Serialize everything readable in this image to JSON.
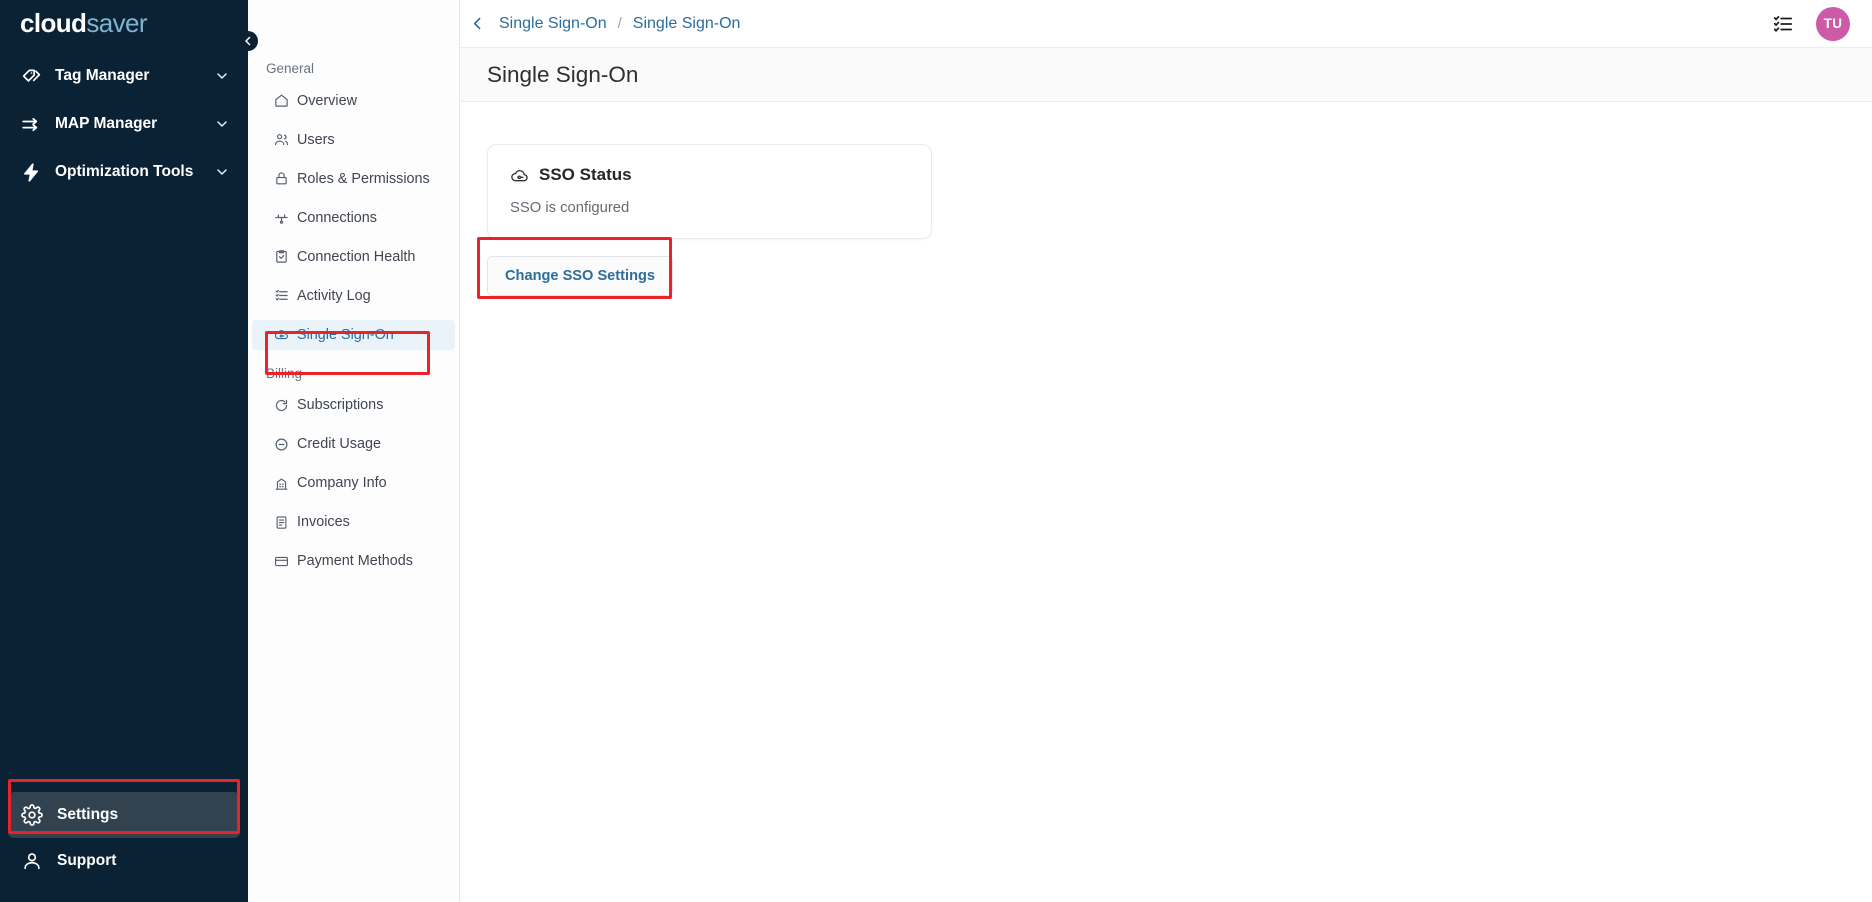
{
  "brand": {
    "primary": "cloud",
    "secondary": "saver"
  },
  "colors": {
    "sidebar_bg": "#0b2234",
    "accent_link": "#2b6e9e",
    "avatar_bg": "#cd5aa7",
    "annotation": "#e8242a",
    "active_item_bg": "#eaf3fa"
  },
  "primary_nav": {
    "items": [
      {
        "label": "Tag Manager",
        "icon": "tag-icon",
        "has_chevron": true
      },
      {
        "label": "MAP Manager",
        "icon": "arrows-right-icon",
        "has_chevron": true
      },
      {
        "label": "Optimization Tools",
        "icon": "lightning-bolt-icon",
        "has_chevron": true
      }
    ],
    "bottom_items": [
      {
        "label": "Settings",
        "icon": "gear-icon",
        "active": true
      },
      {
        "label": "Support",
        "icon": "headset-icon",
        "active": false
      }
    ],
    "collapse_icon": "chevron-left-icon"
  },
  "settings_sidebar": {
    "groups": [
      {
        "label": "General",
        "items": [
          {
            "label": "Overview",
            "icon": "home-icon",
            "active": false
          },
          {
            "label": "Users",
            "icon": "users-icon",
            "active": false
          },
          {
            "label": "Roles & Permissions",
            "icon": "lock-icon",
            "active": false
          },
          {
            "label": "Connections",
            "icon": "plug-icon",
            "active": false
          },
          {
            "label": "Connection Health",
            "icon": "clipboard-check-icon",
            "active": false
          },
          {
            "label": "Activity Log",
            "icon": "list-icon",
            "active": false
          },
          {
            "label": "Single Sign-On",
            "icon": "cloud-key-icon",
            "active": true
          }
        ]
      },
      {
        "label": "Billing",
        "items": [
          {
            "label": "Subscriptions",
            "icon": "refresh-icon",
            "active": false
          },
          {
            "label": "Credit Usage",
            "icon": "circle-minus-icon",
            "active": false
          },
          {
            "label": "Company Info",
            "icon": "building-icon",
            "active": false
          },
          {
            "label": "Invoices",
            "icon": "document-icon",
            "active": false
          },
          {
            "label": "Payment Methods",
            "icon": "credit-card-icon",
            "active": false
          }
        ]
      }
    ]
  },
  "topbar": {
    "back_icon": "chevron-left-icon",
    "breadcrumb_parent": "Single Sign-On",
    "breadcrumb_separator": "/",
    "breadcrumb_current": "Single Sign-On",
    "checklist_icon": "checklist-icon",
    "avatar_initials": "TU"
  },
  "page": {
    "title": "Single Sign-On"
  },
  "sso_card": {
    "icon": "cloud-key-icon",
    "title": "SSO Status",
    "status_text": "SSO is configured"
  },
  "actions": {
    "change_sso_label": "Change SSO Settings"
  }
}
